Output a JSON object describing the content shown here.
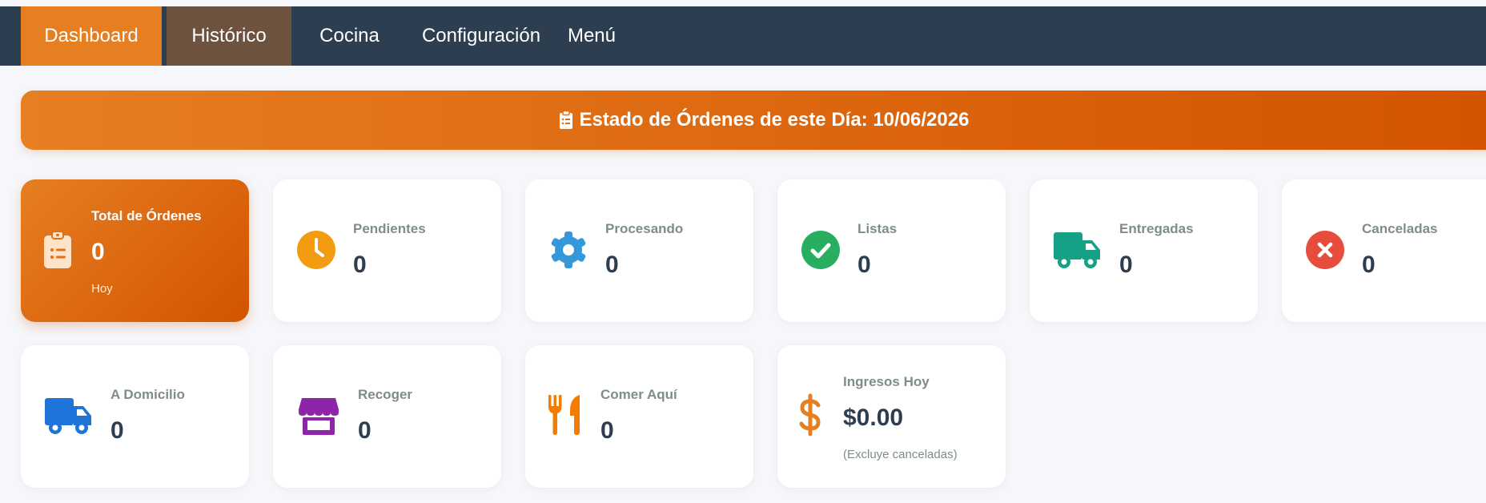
{
  "nav": {
    "tabs": [
      {
        "label": "Dashboard",
        "active": true
      },
      {
        "label": "Histórico"
      },
      {
        "label": "Cocina"
      },
      {
        "label": "Configuración"
      },
      {
        "label": "Menú"
      }
    ]
  },
  "banner": {
    "title": "Estado de Órdenes de este Día: 10/06/2026",
    "icon": "clipboard-icon"
  },
  "stats": {
    "total": {
      "label": "Total de Órdenes",
      "value": "0",
      "note": "Hoy",
      "icon": "clipboard-list-icon"
    },
    "pendientes": {
      "label": "Pendientes",
      "value": "0",
      "icon": "clock-icon",
      "color": "#f39c12"
    },
    "procesando": {
      "label": "Procesando",
      "value": "0",
      "icon": "gear-icon",
      "color": "#3498db"
    },
    "listas": {
      "label": "Listas",
      "value": "0",
      "icon": "check-circle-icon",
      "color": "#27ae60"
    },
    "entregadas": {
      "label": "Entregadas",
      "value": "0",
      "icon": "truck-icon",
      "color": "#16a085"
    },
    "canceladas": {
      "label": "Canceladas",
      "value": "0",
      "icon": "x-circle-icon",
      "color": "#e74c3c"
    },
    "domicilio": {
      "label": "A Domicilio",
      "value": "0",
      "icon": "delivery-truck-icon",
      "color": "#1e74d9"
    },
    "recoger": {
      "label": "Recoger",
      "value": "0",
      "icon": "store-icon",
      "color": "#8e24aa"
    },
    "comer": {
      "label": "Comer Aquí",
      "value": "0",
      "icon": "utensils-icon",
      "color": "#f57c00"
    },
    "ingresos": {
      "label": "Ingresos Hoy",
      "value": "$0.00",
      "note": "(Excluye canceladas)",
      "icon": "dollar-icon",
      "color": "#e67e22"
    }
  },
  "colors": {
    "nav_bg": "#2c3e50",
    "accent": "#e67e22",
    "accent_dark": "#d35400",
    "historico_bg": "#6d533f"
  }
}
